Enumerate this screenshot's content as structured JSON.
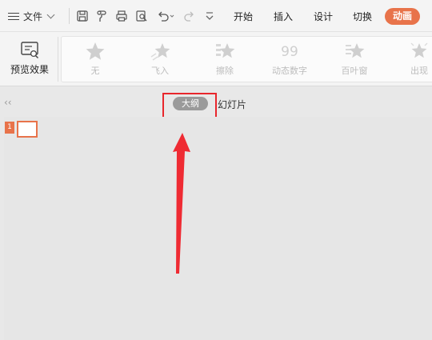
{
  "menubar": {
    "file_label": "文件",
    "tabs": [
      "开始",
      "插入",
      "设计",
      "切换"
    ],
    "active_tab": "动画",
    "active_color": "#e8734a"
  },
  "ribbon": {
    "preview_label": "预览效果",
    "effects": [
      {
        "label": "无",
        "icon": "star-icon"
      },
      {
        "label": "飞入",
        "icon": "fly-in-star-icon"
      },
      {
        "label": "擦除",
        "icon": "wipe-star-icon"
      },
      {
        "label": "动态数字",
        "icon": "dynamic-number-icon"
      },
      {
        "label": "百叶窗",
        "icon": "blinds-star-icon"
      },
      {
        "label": "出现",
        "icon": "appear-star-icon"
      }
    ]
  },
  "panel": {
    "outline_tab": "大纲",
    "slides_tab": "幻灯片",
    "highlight_color": "#e8262c"
  },
  "slides": [
    {
      "number": "1"
    }
  ]
}
